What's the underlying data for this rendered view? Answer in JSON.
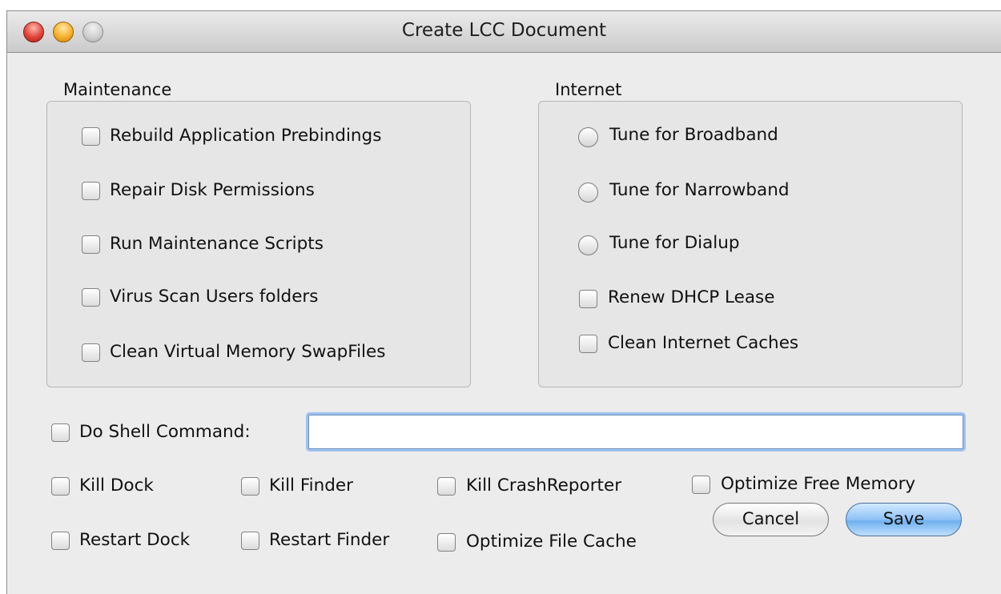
{
  "window": {
    "title": "Create LCC Document"
  },
  "maintenance": {
    "label": "Maintenance",
    "items": [
      "Rebuild Application Prebindings",
      "Repair Disk Permissions",
      "Run Maintenance Scripts",
      "Virus Scan Users folders",
      "Clean Virtual Memory SwapFiles"
    ]
  },
  "internet": {
    "label": "Internet",
    "radios": [
      "Tune for Broadband",
      "Tune for Narrowband",
      "Tune for Dialup"
    ],
    "checks": [
      "Renew DHCP Lease",
      "Clean Internet Caches"
    ]
  },
  "shell": {
    "label": "Do Shell Command:",
    "value": "",
    "placeholder": ""
  },
  "row1": [
    "Kill Dock",
    "Kill Finder",
    "Kill CrashReporter",
    "Optimize Free Memory"
  ],
  "row2": [
    "Restart Dock",
    "Restart Finder",
    "Optimize File Cache"
  ],
  "buttons": {
    "cancel": "Cancel",
    "save": "Save"
  },
  "colors": {
    "accent": "#6fb0f0",
    "focus_ring": "#9ec2ee"
  }
}
